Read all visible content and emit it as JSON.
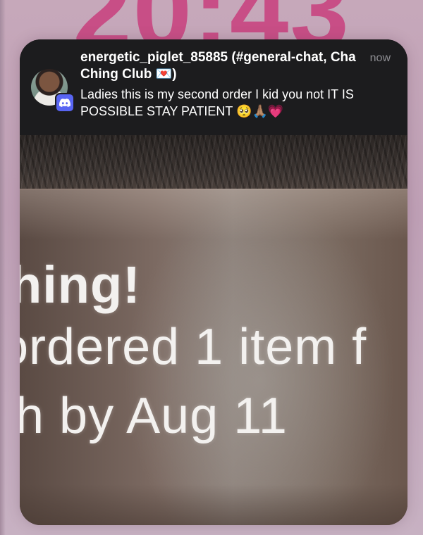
{
  "lock_screen": {
    "clock_text": "20:43"
  },
  "notification": {
    "app_icon": "discord-icon",
    "avatar_icon": "user-avatar",
    "sender_title": "energetic_piglet_85885 (#general-chat, Cha Ching Club 💌)",
    "time": "now",
    "message": "Ladies this is my second order I kid you not IT IS POSSIBLE STAY PATIENT 🥺🙏🏽💗"
  },
  "preview_image": {
    "line1": "hing!",
    "line2": "ordered 1 item f",
    "line3": "h by Aug 11"
  },
  "colors": {
    "clock": "#c84e86",
    "card_background": "#1c1c1e",
    "discord_brand": "#5865f2"
  }
}
